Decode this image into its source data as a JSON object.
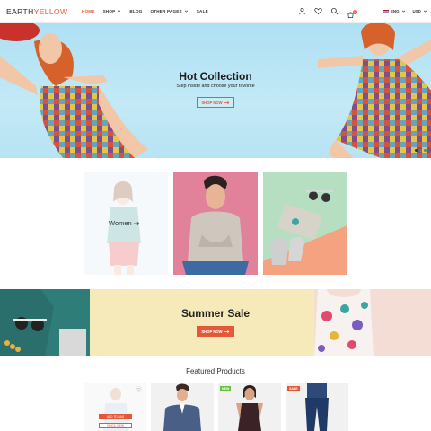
{
  "brand": {
    "part1": "EARTH",
    "part2": "YELLOW",
    "accent_color": "#e4583a"
  },
  "nav": {
    "home": "HOME",
    "shop": "SHOP",
    "blog": "BLOG",
    "other_pages": "OTHER PAGES",
    "sale": "SALE"
  },
  "header_icons": [
    "user-icon",
    "heart-icon",
    "search-icon",
    "cart-icon"
  ],
  "cart_count": "0",
  "locale": {
    "language": "ENG",
    "currency": "USD"
  },
  "hero": {
    "title": "Hot Collection",
    "subtitle": "Step inside and choose your favorite",
    "button": "SHOP NOW"
  },
  "categories": [
    {
      "label": "Women"
    }
  ],
  "summer": {
    "title": "Summer Sale",
    "button": "SHOP NOW"
  },
  "featured": {
    "title": "Featured Products",
    "add_to_bag": "ADD TO BAG",
    "quick_view": "QUICK VIEW",
    "badges": {
      "new": "NEW",
      "sale": "SALE"
    }
  }
}
